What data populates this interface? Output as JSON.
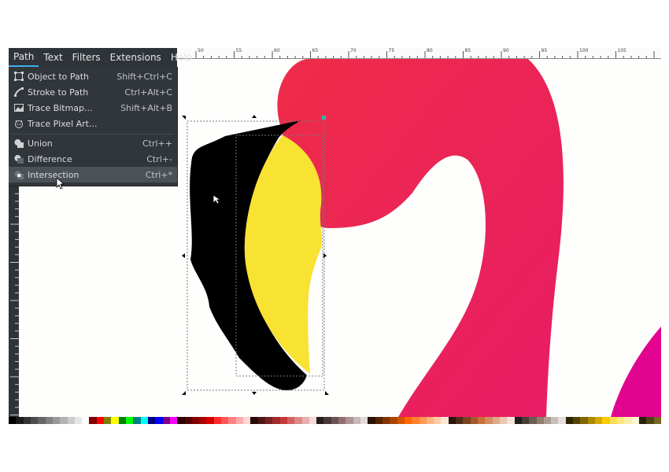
{
  "menubar": {
    "items": [
      "Path",
      "Text",
      "Filters",
      "Extensions",
      "Help"
    ]
  },
  "path_menu": {
    "object_to_path": {
      "label": "Object to Path",
      "shortcut": "Shift+Ctrl+C"
    },
    "stroke_to_path": {
      "label": "Stroke to Path",
      "shortcut": "Ctrl+Alt+C"
    },
    "trace_bitmap": {
      "label": "Trace Bitmap...",
      "shortcut": "Shift+Alt+B"
    },
    "trace_pixel_art": {
      "label": "Trace Pixel Art...",
      "shortcut": ""
    },
    "union": {
      "label": "Union",
      "shortcut": "Ctrl++"
    },
    "difference": {
      "label": "Difference",
      "shortcut": "Ctrl+-"
    },
    "intersection": {
      "label": "Intersection",
      "shortcut": "Ctrl+*"
    }
  },
  "ruler": {
    "labels": [
      "50",
      "55",
      "60",
      "65",
      "70",
      "75",
      "80",
      "85",
      "90",
      "95",
      "100",
      "105"
    ]
  },
  "colors": {
    "accent": "#3daee9",
    "flamingo_pink": "#ed2a4e",
    "beak_black": "#000000",
    "beak_yellow": "#f8e232",
    "magenta": "#e2048f"
  },
  "palette": [
    "#000000",
    "#1a1a1a",
    "#333333",
    "#4d4d4d",
    "#666666",
    "#808080",
    "#999999",
    "#b3b3b3",
    "#cccccc",
    "#e6e6e6",
    "#ffffff",
    "#800000",
    "#ff0000",
    "#808000",
    "#ffff00",
    "#008000",
    "#00ff00",
    "#008080",
    "#00ffff",
    "#000080",
    "#0000ff",
    "#800080",
    "#ff00ff",
    "#2b0000",
    "#550000",
    "#800000",
    "#aa0000",
    "#d40000",
    "#ff2a2a",
    "#ff5555",
    "#ff8080",
    "#ffaaaa",
    "#ffd5d5",
    "#280b0b",
    "#501616",
    "#782121",
    "#a02c2c",
    "#c83737",
    "#d35f5f",
    "#de8787",
    "#e9afaf",
    "#f4d7d7",
    "#241c1c",
    "#483737",
    "#6c5353",
    "#916f6f",
    "#ac9393",
    "#c8b7b7",
    "#e3dbdb",
    "#2b1100",
    "#552200",
    "#803300",
    "#aa4400",
    "#d45500",
    "#ff6600",
    "#ff7f2a",
    "#ff9955",
    "#ffb380",
    "#ffccaa",
    "#ffe6d5",
    "#28170b",
    "#502d16",
    "#784421",
    "#a05a2c",
    "#c87137",
    "#d38d5f",
    "#deaa87",
    "#e9c6af",
    "#f4e3d7",
    "#241f1c",
    "#483e37",
    "#6c5d53",
    "#917c6f",
    "#ac9d93",
    "#c8beb7",
    "#e3dedb",
    "#2b2200",
    "#554400",
    "#806600",
    "#aa8800",
    "#d4aa00",
    "#ffcc00",
    "#ffdd55",
    "#ffe680",
    "#ffeeaa",
    "#fff6d5",
    "#28220b",
    "#504416",
    "#786721"
  ]
}
